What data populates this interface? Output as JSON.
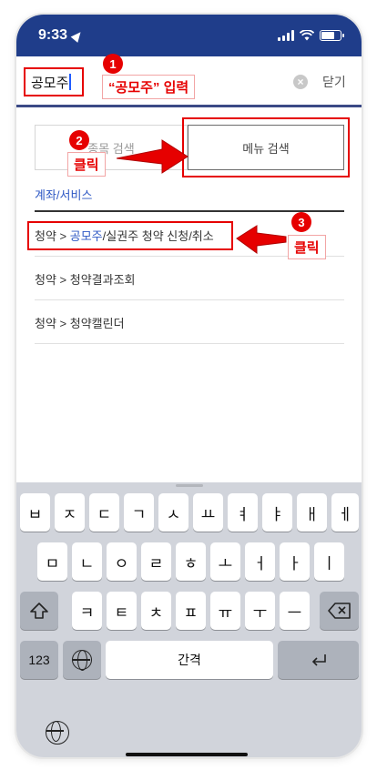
{
  "status_bar": {
    "time": "9:33",
    "location_icon": "location-arrow-icon",
    "signal_icon": "cellular-signal-icon",
    "wifi_icon": "wifi-icon",
    "battery_icon": "battery-icon"
  },
  "search": {
    "value": "공모주",
    "clear_icon": "clear-circle-icon",
    "close_label": "닫기"
  },
  "tabs": [
    {
      "label": "종목 검색"
    },
    {
      "label": "메뉴 검색"
    }
  ],
  "section_title": "계좌/서비스",
  "results": [
    {
      "prefix": "청약 > ",
      "highlight": "공모주",
      "suffix": "/실권주 청약 신청/취소"
    },
    {
      "prefix": "청약 > 청약결과조회",
      "highlight": "",
      "suffix": ""
    },
    {
      "prefix": "청약 > 청약캘린더",
      "highlight": "",
      "suffix": ""
    }
  ],
  "annotations": {
    "step1": {
      "number": "1",
      "label": "“공모주” 입력"
    },
    "step2": {
      "number": "2",
      "label": "클릭"
    },
    "step3": {
      "number": "3",
      "label": "클릭"
    }
  },
  "keyboard": {
    "row1": [
      "ㅂ",
      "ㅈ",
      "ㄷ",
      "ㄱ",
      "ㅅ",
      "ㅛ",
      "ㅕ",
      "ㅑ",
      "ㅐ",
      "ㅔ"
    ],
    "row2": [
      "ㅁ",
      "ㄴ",
      "ㅇ",
      "ㄹ",
      "ㅎ",
      "ㅗ",
      "ㅓ",
      "ㅏ",
      "ㅣ"
    ],
    "row3": [
      "ㅋ",
      "ㅌ",
      "ㅊ",
      "ㅍ",
      "ㅠ",
      "ㅜ",
      "ㅡ"
    ],
    "numbers_label": "123",
    "space_label": "간격",
    "shift_icon": "shift-icon",
    "delete_icon": "delete-backspace-icon",
    "return_icon": "return-icon",
    "globe_icon": "globe-icon"
  },
  "colors": {
    "header": "#1f3d8a",
    "accent_blue": "#2d57c4",
    "annotation_red": "#e60000"
  }
}
